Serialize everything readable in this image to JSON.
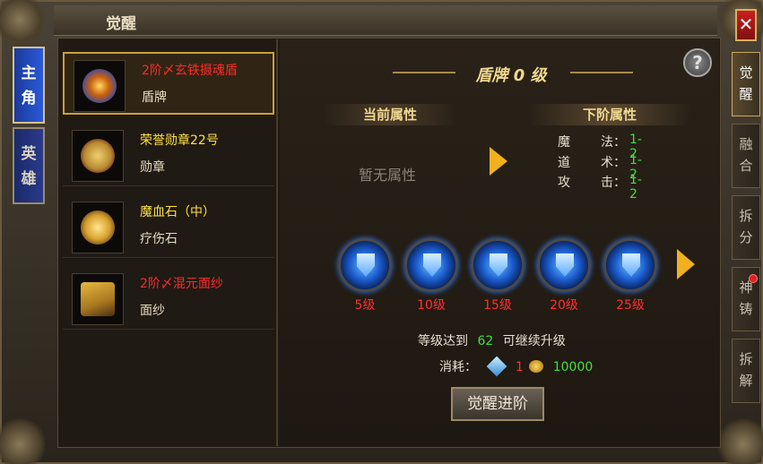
{
  "window": {
    "title": "觉醒",
    "close_label": "✕"
  },
  "left_tabs": [
    {
      "label_chars": [
        "主",
        "角"
      ],
      "active": true
    },
    {
      "label_chars": [
        "英",
        "雄"
      ],
      "active": false
    }
  ],
  "items": [
    {
      "name": "2阶〆玄铁摄魂盾",
      "type": "盾牌",
      "name_color": "red",
      "icon": "shield-orb-icon",
      "selected": true
    },
    {
      "name": "荣誉勋章22号",
      "type": "勋章",
      "name_color": "yellow",
      "icon": "medal-icon",
      "selected": false
    },
    {
      "name": "魔血石（中）",
      "type": "疗伤石",
      "name_color": "yellow",
      "icon": "blood-stone-icon",
      "selected": false
    },
    {
      "name": "2阶〆混元面纱",
      "type": "面纱",
      "name_color": "red",
      "icon": "veil-icon",
      "selected": false
    }
  ],
  "detail": {
    "heading": "盾牌 0 级",
    "current_attr_title": "当前属性",
    "next_attr_title": "下阶属性",
    "current_attr_empty": "暂无属性",
    "next_attrs": [
      {
        "c1": "魔",
        "c2": "法：",
        "value": "1-2"
      },
      {
        "c1": "道",
        "c2": "术：",
        "value": "1-2"
      },
      {
        "c1": "攻",
        "c2": "击：",
        "value": "1-2"
      }
    ],
    "levels": [
      "5级",
      "10级",
      "15级",
      "20级",
      "25级"
    ],
    "requirement_prefix": "等级达到",
    "requirement_level": "62",
    "requirement_suffix": "可继续升级",
    "cost_label": "消耗：",
    "cost_item_count": "1",
    "cost_gold": "10000",
    "action_button": "觉醒进阶",
    "help_label": "?"
  },
  "right_tabs": [
    {
      "chars": [
        "觉",
        "醒"
      ],
      "active": true
    },
    {
      "chars": [
        "融",
        "合"
      ],
      "active": false
    },
    {
      "chars": [
        "拆",
        "分"
      ],
      "active": false
    },
    {
      "chars": [
        "神",
        "铸"
      ],
      "active": false,
      "badge": true
    },
    {
      "chars": [
        "拆",
        "解"
      ],
      "active": false
    }
  ],
  "colors": {
    "accent_gold": "#f0d890",
    "value_green": "#40e040",
    "level_red": "#ff3030"
  }
}
